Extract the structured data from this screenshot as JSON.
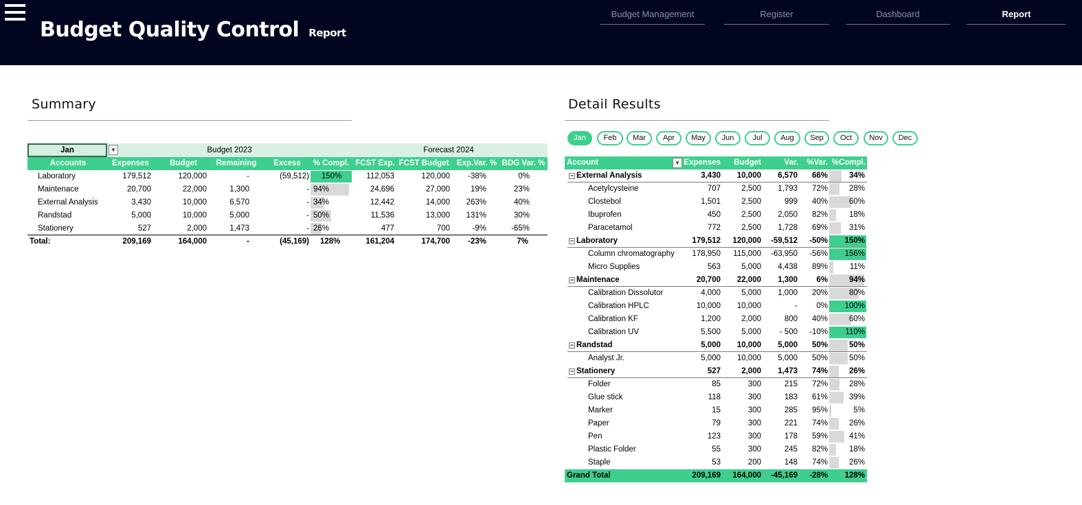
{
  "header": {
    "title": "Budget Quality Control",
    "subtitle": "Report",
    "nav": [
      "Budget Management",
      "Register",
      "Dashboard",
      "Report"
    ],
    "active_nav": "Report"
  },
  "summary": {
    "title": "Summary",
    "selected_month": "Jan",
    "group_budget": "Budget 2023",
    "group_forecast": "Forecast 2024",
    "columns": [
      "Accounts",
      "Expenses",
      "Budget",
      "Remaining",
      "Excess",
      "% Compl.",
      "FCST Exp.",
      "FCST Budget",
      "Exp.Var. %",
      "BDG Var. %"
    ],
    "rows": [
      {
        "account": "Laboratory",
        "expenses": "179,512",
        "budget": "120,000",
        "remaining": "-",
        "excess": "(59,512)",
        "compl": "150%",
        "compl_value": 1.5,
        "fcst_exp": "112,053",
        "fcst_budget": "120,000",
        "exp_var": "-38%",
        "bdg_var": "0%"
      },
      {
        "account": "Maintenace",
        "expenses": "20,700",
        "budget": "22,000",
        "remaining": "1,300",
        "excess": "-",
        "compl": "94%",
        "compl_value": 0.94,
        "fcst_exp": "24,696",
        "fcst_budget": "27,000",
        "exp_var": "19%",
        "bdg_var": "23%"
      },
      {
        "account": "External Analysis",
        "expenses": "3,430",
        "budget": "10,000",
        "remaining": "6,570",
        "excess": "-",
        "compl": "34%",
        "compl_value": 0.34,
        "fcst_exp": "12,442",
        "fcst_budget": "14,000",
        "exp_var": "263%",
        "bdg_var": "40%"
      },
      {
        "account": "Randstad",
        "expenses": "5,000",
        "budget": "10,000",
        "remaining": "5,000",
        "excess": "-",
        "compl": "50%",
        "compl_value": 0.5,
        "fcst_exp": "11,536",
        "fcst_budget": "13,000",
        "exp_var": "131%",
        "bdg_var": "30%"
      },
      {
        "account": "Stationery",
        "expenses": "527",
        "budget": "2,000",
        "remaining": "1,473",
        "excess": "-",
        "compl": "26%",
        "compl_value": 0.26,
        "fcst_exp": "477",
        "fcst_budget": "700",
        "exp_var": "-9%",
        "bdg_var": "-65%"
      }
    ],
    "total": {
      "account": "Total:",
      "expenses": "209,169",
      "budget": "164,000",
      "remaining": "-",
      "excess": "(45,169)",
      "compl": "128%",
      "fcst_exp": "161,204",
      "fcst_budget": "174,700",
      "exp_var": "-23%",
      "bdg_var": "7%"
    }
  },
  "detail": {
    "title": "Detail Results",
    "months": [
      "Jan",
      "Feb",
      "Mar",
      "Apr",
      "May",
      "Jun",
      "Jul",
      "Aug",
      "Sep",
      "Oct",
      "Nov",
      "Dec"
    ],
    "active_month": "Jan",
    "columns": [
      "Account",
      "Expenses",
      "Budget",
      "Var.",
      "%Var.",
      "%Compl."
    ],
    "rows": [
      {
        "group": true,
        "account": "External Analysis",
        "expenses": "3,430",
        "budget": "10,000",
        "var": "6,570",
        "pvar": "66%",
        "compl": "34%",
        "compl_value": 0.34
      },
      {
        "group": false,
        "account": "Acetylcysteine",
        "expenses": "707",
        "budget": "2,500",
        "var": "1,793",
        "pvar": "72%",
        "compl": "28%",
        "compl_value": 0.28
      },
      {
        "group": false,
        "account": "Clostebol",
        "expenses": "1,501",
        "budget": "2,500",
        "var": "999",
        "pvar": "40%",
        "compl": "60%",
        "compl_value": 0.6
      },
      {
        "group": false,
        "account": "Ibuprofen",
        "expenses": "450",
        "budget": "2,500",
        "var": "2,050",
        "pvar": "82%",
        "compl": "18%",
        "compl_value": 0.18
      },
      {
        "group": false,
        "account": "Paracetamol",
        "expenses": "772",
        "budget": "2,500",
        "var": "1,728",
        "pvar": "69%",
        "compl": "31%",
        "compl_value": 0.31
      },
      {
        "group": true,
        "account": "Laboratory",
        "expenses": "179,512",
        "budget": "120,000",
        "var": "-59,512",
        "pvar": "-50%",
        "compl": "150%",
        "compl_value": 1.5
      },
      {
        "group": false,
        "account": "Column chromatography",
        "expenses": "178,950",
        "budget": "115,000",
        "var": "-63,950",
        "pvar": "-56%",
        "compl": "156%",
        "compl_value": 1.56
      },
      {
        "group": false,
        "account": "Micro Supplies",
        "expenses": "563",
        "budget": "5,000",
        "var": "4,438",
        "pvar": "89%",
        "compl": "11%",
        "compl_value": 0.11
      },
      {
        "group": true,
        "account": "Maintenace",
        "expenses": "20,700",
        "budget": "22,000",
        "var": "1,300",
        "pvar": "6%",
        "compl": "94%",
        "compl_value": 0.94
      },
      {
        "group": false,
        "account": "Calibration Dissolutor",
        "expenses": "4,000",
        "budget": "5,000",
        "var": "1,000",
        "pvar": "20%",
        "compl": "80%",
        "compl_value": 0.8
      },
      {
        "group": false,
        "account": "Calibration HPLC",
        "expenses": "10,000",
        "budget": "10,000",
        "var": "-",
        "pvar": "0%",
        "compl": "100%",
        "compl_value": 1.0
      },
      {
        "group": false,
        "account": "Calibration KF",
        "expenses": "1,200",
        "budget": "2,000",
        "var": "800",
        "pvar": "40%",
        "compl": "60%",
        "compl_value": 0.6
      },
      {
        "group": false,
        "account": "Calibration UV",
        "expenses": "5,500",
        "budget": "5,000",
        "var": "-   500",
        "pvar": "-10%",
        "compl": "110%",
        "compl_value": 1.1
      },
      {
        "group": true,
        "account": "Randstad",
        "expenses": "5,000",
        "budget": "10,000",
        "var": "5,000",
        "pvar": "50%",
        "compl": "50%",
        "compl_value": 0.5
      },
      {
        "group": false,
        "account": "Analyst Jr.",
        "expenses": "5,000",
        "budget": "10,000",
        "var": "5,000",
        "pvar": "50%",
        "compl": "50%",
        "compl_value": 0.5
      },
      {
        "group": true,
        "account": "Stationery",
        "expenses": "527",
        "budget": "2,000",
        "var": "1,473",
        "pvar": "74%",
        "compl": "26%",
        "compl_value": 0.26
      },
      {
        "group": false,
        "account": "Folder",
        "expenses": "85",
        "budget": "300",
        "var": "215",
        "pvar": "72%",
        "compl": "28%",
        "compl_value": 0.28
      },
      {
        "group": false,
        "account": "Glue stick",
        "expenses": "118",
        "budget": "300",
        "var": "183",
        "pvar": "61%",
        "compl": "39%",
        "compl_value": 0.39
      },
      {
        "group": false,
        "account": "Marker",
        "expenses": "15",
        "budget": "300",
        "var": "285",
        "pvar": "95%",
        "compl": "5%",
        "compl_value": 0.05
      },
      {
        "group": false,
        "account": "Paper",
        "expenses": "79",
        "budget": "300",
        "var": "221",
        "pvar": "74%",
        "compl": "26%",
        "compl_value": 0.26
      },
      {
        "group": false,
        "account": "Pen",
        "expenses": "123",
        "budget": "300",
        "var": "178",
        "pvar": "59%",
        "compl": "41%",
        "compl_value": 0.41
      },
      {
        "group": false,
        "account": "Plastic Folder",
        "expenses": "55",
        "budget": "300",
        "var": "245",
        "pvar": "82%",
        "compl": "18%",
        "compl_value": 0.18
      },
      {
        "group": false,
        "account": "Staple",
        "expenses": "53",
        "budget": "200",
        "var": "148",
        "pvar": "74%",
        "compl": "26%",
        "compl_value": 0.26
      }
    ],
    "grand_total": {
      "account": "Grand Total",
      "expenses": "209,169",
      "budget": "164,000",
      "var": "-45,169",
      "pvar": "-28%",
      "compl": "128%"
    }
  },
  "colors": {
    "header_bg": "#020520",
    "accent": "#3ecf8e",
    "bar_gray": "#d9d9d9"
  },
  "icons": {
    "menu": "hamburger-icon",
    "collapse": "minus-box-icon",
    "filter": "dropdown-arrow-icon"
  }
}
